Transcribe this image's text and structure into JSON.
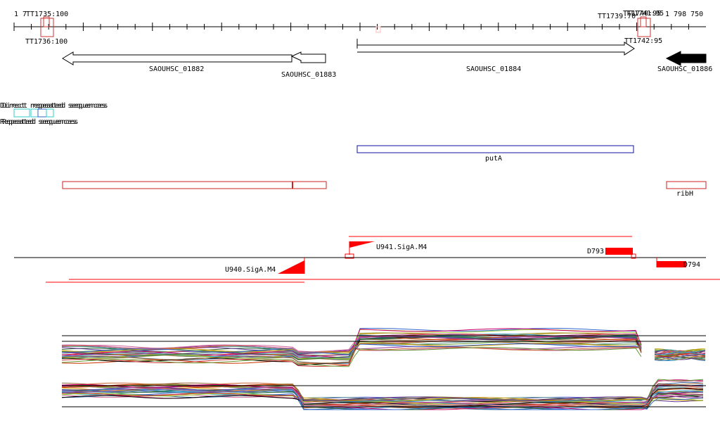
{
  "ruler": {
    "start_label": "1 7",
    "end_label": "1 798 750",
    "tss_labels": [
      {
        "text": "TT1735:100"
      },
      {
        "text": "TT1736:100"
      },
      {
        "text": "TT1739:70"
      },
      {
        "text": "TT1740:95"
      },
      {
        "text": "TT1741:95"
      },
      {
        "text": "TT1742:95"
      }
    ]
  },
  "genes": [
    {
      "id": "SAOUHSC_01882",
      "strand": "minus",
      "filled": false
    },
    {
      "id": "SAOUHSC_01883",
      "strand": "minus",
      "filled": false
    },
    {
      "id": "SAOUHSC_01884",
      "strand": "plus",
      "filled": false
    },
    {
      "id": "SAOUHSC_01886",
      "strand": "minus",
      "filled": true
    }
  ],
  "repeat_track": {
    "labels": [
      "Direct repeated sequences",
      "Repeated sequences"
    ]
  },
  "operon_blue": {
    "label": "putA"
  },
  "operon_red": {
    "label": "ribH"
  },
  "segments": [
    {
      "label": "U941.SigA.M4"
    },
    {
      "label": "U940.SigA.M4"
    },
    {
      "label": "D793"
    },
    {
      "label": "D794"
    }
  ],
  "colors": {
    "tss": "#cc3333",
    "gene_outline": "#000000",
    "operon_blue": "#1010a0",
    "operon_red": "#cc2222",
    "segment": "#ff0000",
    "repeat": "#33cccc"
  }
}
